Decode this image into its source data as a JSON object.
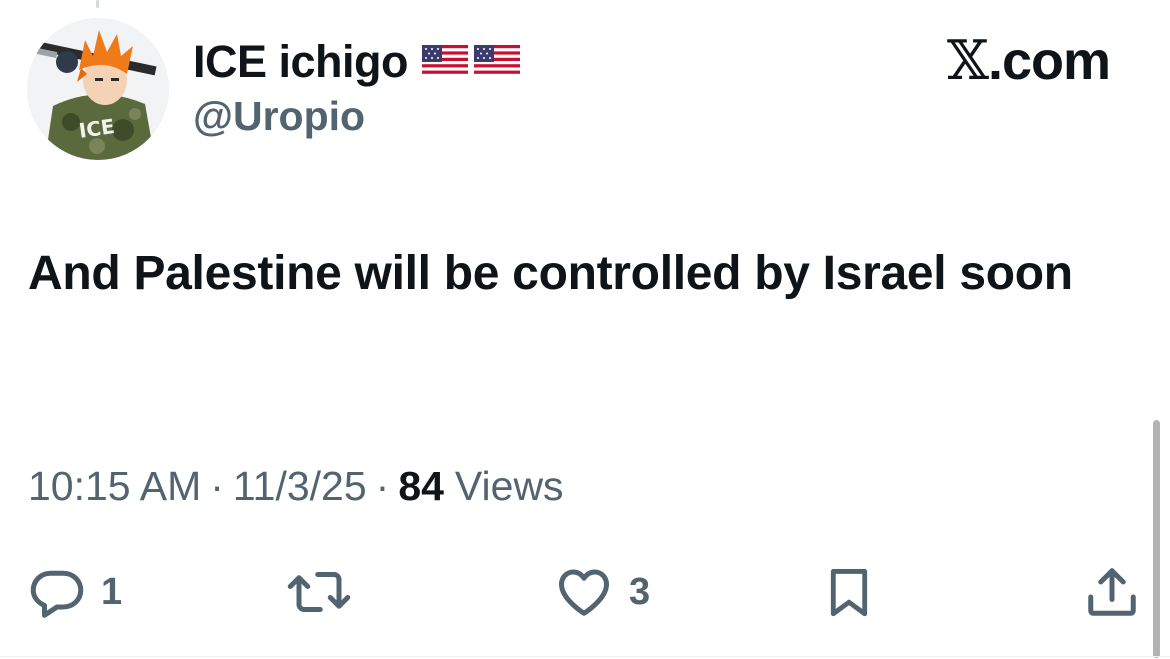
{
  "author": {
    "display_name": "ICE ichigo",
    "handle": "@Uropio",
    "flags": [
      "us-flag",
      "us-flag"
    ],
    "avatar_text": "ICE"
  },
  "brand": {
    "x_glyph": "𝕏",
    "domain": ".com"
  },
  "tweet": {
    "text": "And Palestine will be controlled by Israel soon"
  },
  "meta": {
    "time": "10:15 AM",
    "separator": "·",
    "date": "11/3/25",
    "views_count": "84",
    "views_label": "Views"
  },
  "actions": {
    "reply_count": "1",
    "like_count": "3",
    "icons": [
      "reply-icon",
      "retweet-icon",
      "like-icon",
      "bookmark-icon",
      "share-icon"
    ]
  },
  "colors": {
    "text_primary": "#0f1419",
    "text_secondary": "#536471",
    "background": "#ffffff"
  }
}
